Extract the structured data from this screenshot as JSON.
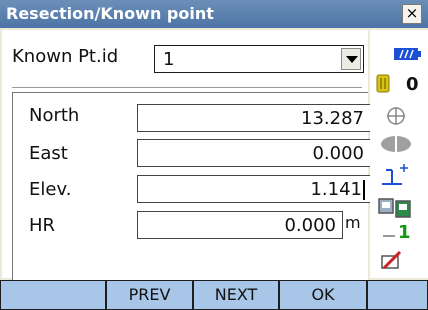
{
  "window": {
    "title": "Resection/Known point",
    "close_label": "×"
  },
  "known_point": {
    "label": "Known Pt.id",
    "value": "1"
  },
  "fields": [
    {
      "label": "North",
      "value": "13.287"
    },
    {
      "label": "East",
      "value": "0.000"
    },
    {
      "label": "Elev.",
      "value": "1.141"
    },
    {
      "label": "HR",
      "value": "0.000",
      "unit": "m"
    }
  ],
  "status": {
    "battery_icon": "battery-icon",
    "memory_count": "0",
    "tilt_icon": "tilt-icon",
    "prism_icon": "prism-icon",
    "target_icon": "target-icon",
    "input_mode_icon": "input-mode-icon",
    "page_number": "1",
    "edit_icon": "edit-icon"
  },
  "softkeys": [
    "",
    "PREV",
    "NEXT",
    "OK",
    ""
  ],
  "colors": {
    "title_bar": "#5a7fb0",
    "softkey_bg": "#a8c6e8",
    "battery": "#1a4fd6",
    "memory": "#d6c21a",
    "page_number": "#119911",
    "edit_icon": "#cc2222"
  }
}
